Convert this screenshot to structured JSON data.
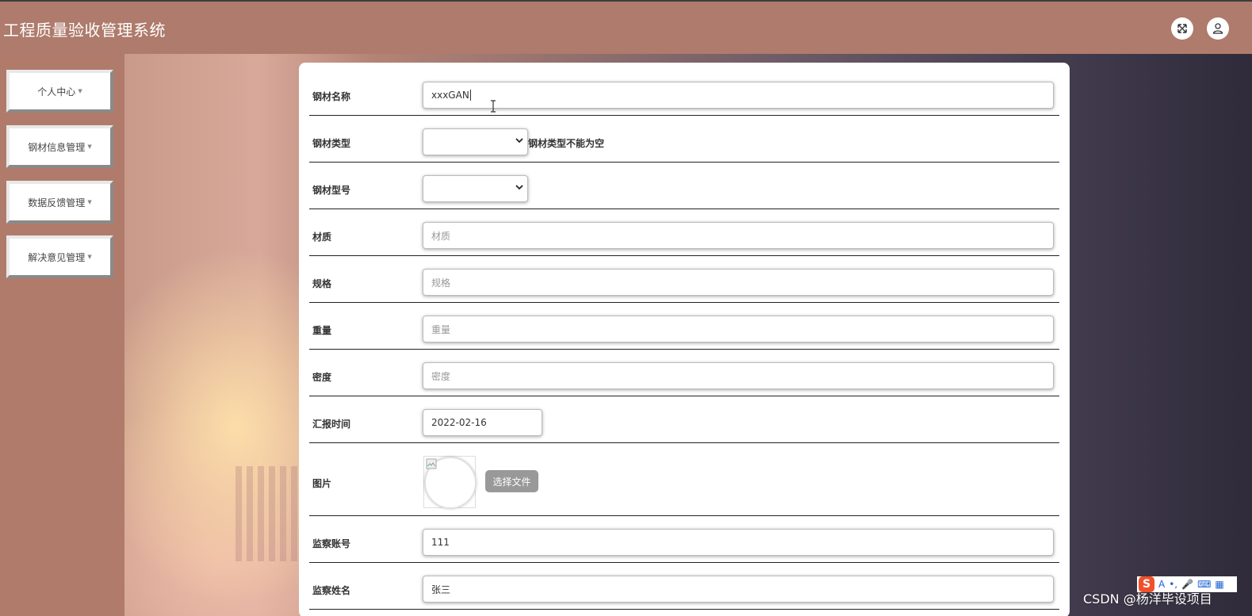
{
  "app": {
    "title": "工程质量验收管理系统"
  },
  "header": {
    "icons": [
      "fullscreen-icon",
      "user-icon"
    ]
  },
  "sidebar": {
    "items": [
      {
        "label": "个人中心"
      },
      {
        "label": "钢材信息管理"
      },
      {
        "label": "数据反馈管理"
      },
      {
        "label": "解决意见管理"
      }
    ]
  },
  "form": {
    "steel_name": {
      "label": "钢材名称",
      "value": "xxxGAN"
    },
    "steel_type": {
      "label": "钢材类型",
      "value": "",
      "error": "钢材类型不能为空"
    },
    "steel_model": {
      "label": "钢材型号",
      "value": ""
    },
    "material": {
      "label": "材质",
      "placeholder": "材质"
    },
    "spec": {
      "label": "规格",
      "placeholder": "规格"
    },
    "weight": {
      "label": "重量",
      "placeholder": "重量"
    },
    "density": {
      "label": "密度",
      "placeholder": "密度"
    },
    "report_time": {
      "label": "汇报时间",
      "value": "2022-02-16"
    },
    "image": {
      "label": "图片",
      "button": "选择文件"
    },
    "supervisor_account": {
      "label": "监察账号",
      "value": "111"
    },
    "supervisor_name": {
      "label": "监察姓名",
      "value": "张三"
    }
  },
  "watermark": "CSDN @杨洋毕设项目",
  "ime_toolbar": {
    "logo": "S",
    "lang": "A"
  }
}
